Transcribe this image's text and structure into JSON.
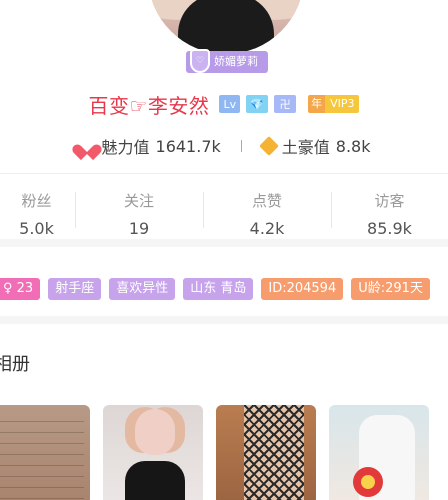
{
  "profile": {
    "badge_label": "娇媚萝莉",
    "username": "百变☞李安然",
    "level_icons": [
      "Lv",
      "💎",
      "卍"
    ],
    "vip": {
      "year": "年",
      "level": "VIP3"
    },
    "charm": {
      "label": "魅力值",
      "value": "1641.7k"
    },
    "wealth": {
      "label": "土豪值",
      "value": "8.8k"
    }
  },
  "counters": [
    {
      "label": "粉丝",
      "value": "5.0k"
    },
    {
      "label": "关注",
      "value": "19"
    },
    {
      "label": "点赞",
      "value": "4.2k"
    },
    {
      "label": "访客",
      "value": "85.9k"
    }
  ],
  "tags": [
    {
      "text": "♀ 23"
    },
    {
      "text": "射手座"
    },
    {
      "text": "喜欢异性"
    },
    {
      "text": "山东 青岛"
    },
    {
      "text": "ID:204594"
    },
    {
      "text": "U龄:291天"
    }
  ],
  "album": {
    "title": "相册"
  }
}
